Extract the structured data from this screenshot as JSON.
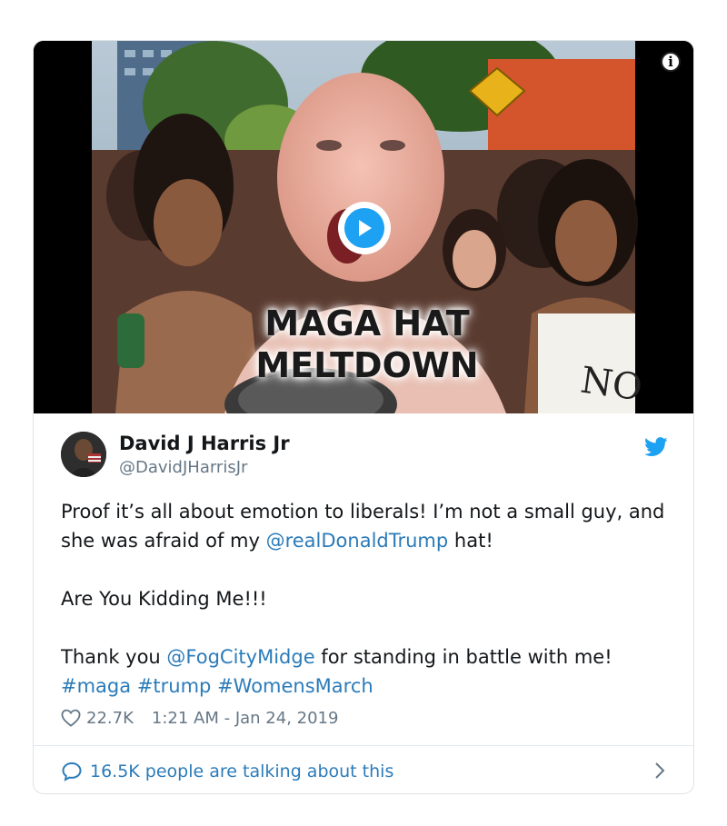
{
  "video": {
    "caption_line1": "MAGA HAT",
    "caption_line2": "MELTDOWN",
    "sign_text": "NO",
    "info_symbol": "i",
    "play_icon": "play-icon"
  },
  "author": {
    "name": "David J Harris Jr",
    "handle": "@DavidJHarrisJr",
    "verified_icon": "twitter-bird-icon"
  },
  "tweet": {
    "p1_part1": "Proof it’s all about emotion to liberals! I’m not a small guy, and she was afraid of my ",
    "p1_mention": "@realDonaldTrump",
    "p1_part2": " hat!",
    "p2": "Are You Kidding Me!!!",
    "p3_part1": "Thank you ",
    "p3_mention": "@FogCityMidge",
    "p3_part2": " for standing in battle with me! ",
    "hashtag1": "#maga",
    "hashtag2": "#trump",
    "hashtag3": "#WomensMarch"
  },
  "meta": {
    "likes": "22.7K",
    "timestamp": "1:21 AM - Jan 24, 2019"
  },
  "footer": {
    "talking_label": "16.5K people are talking about this"
  },
  "colors": {
    "accent": "#1da1f2",
    "link": "#2b7bb9",
    "muted": "#657786",
    "text": "#14171a"
  }
}
